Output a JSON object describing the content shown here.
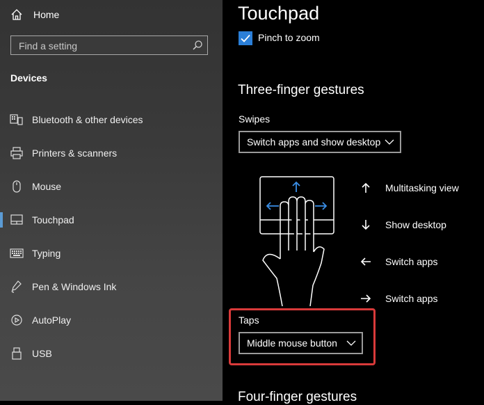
{
  "sidebar": {
    "home_label": "Home",
    "search_placeholder": "Find a setting",
    "section_title": "Devices",
    "items": [
      {
        "label": "Bluetooth & other devices",
        "icon": "bluetooth-devices-icon"
      },
      {
        "label": "Printers & scanners",
        "icon": "printer-icon"
      },
      {
        "label": "Mouse",
        "icon": "mouse-icon"
      },
      {
        "label": "Touchpad",
        "icon": "touchpad-icon",
        "selected": true
      },
      {
        "label": "Typing",
        "icon": "keyboard-icon"
      },
      {
        "label": "Pen & Windows Ink",
        "icon": "pen-icon"
      },
      {
        "label": "AutoPlay",
        "icon": "autoplay-icon"
      },
      {
        "label": "USB",
        "icon": "usb-icon"
      }
    ]
  },
  "main": {
    "title": "Touchpad",
    "pinch_to_zoom": {
      "label": "Pinch to zoom",
      "checked": true
    },
    "three_finger": {
      "heading": "Three-finger gestures",
      "swipes_label": "Swipes",
      "swipes_value": "Switch apps and show desktop",
      "gestures": [
        {
          "direction": "up",
          "label": "Multitasking view"
        },
        {
          "direction": "down",
          "label": "Show desktop"
        },
        {
          "direction": "left",
          "label": "Switch apps"
        },
        {
          "direction": "right",
          "label": "Switch apps"
        }
      ],
      "taps_label": "Taps",
      "taps_value": "Middle mouse button"
    },
    "four_finger_heading": "Four-finger gestures"
  },
  "colors": {
    "accent": "#2b7fd8",
    "highlight": "#d93a3a",
    "selection_bar": "#5b9bd5"
  }
}
